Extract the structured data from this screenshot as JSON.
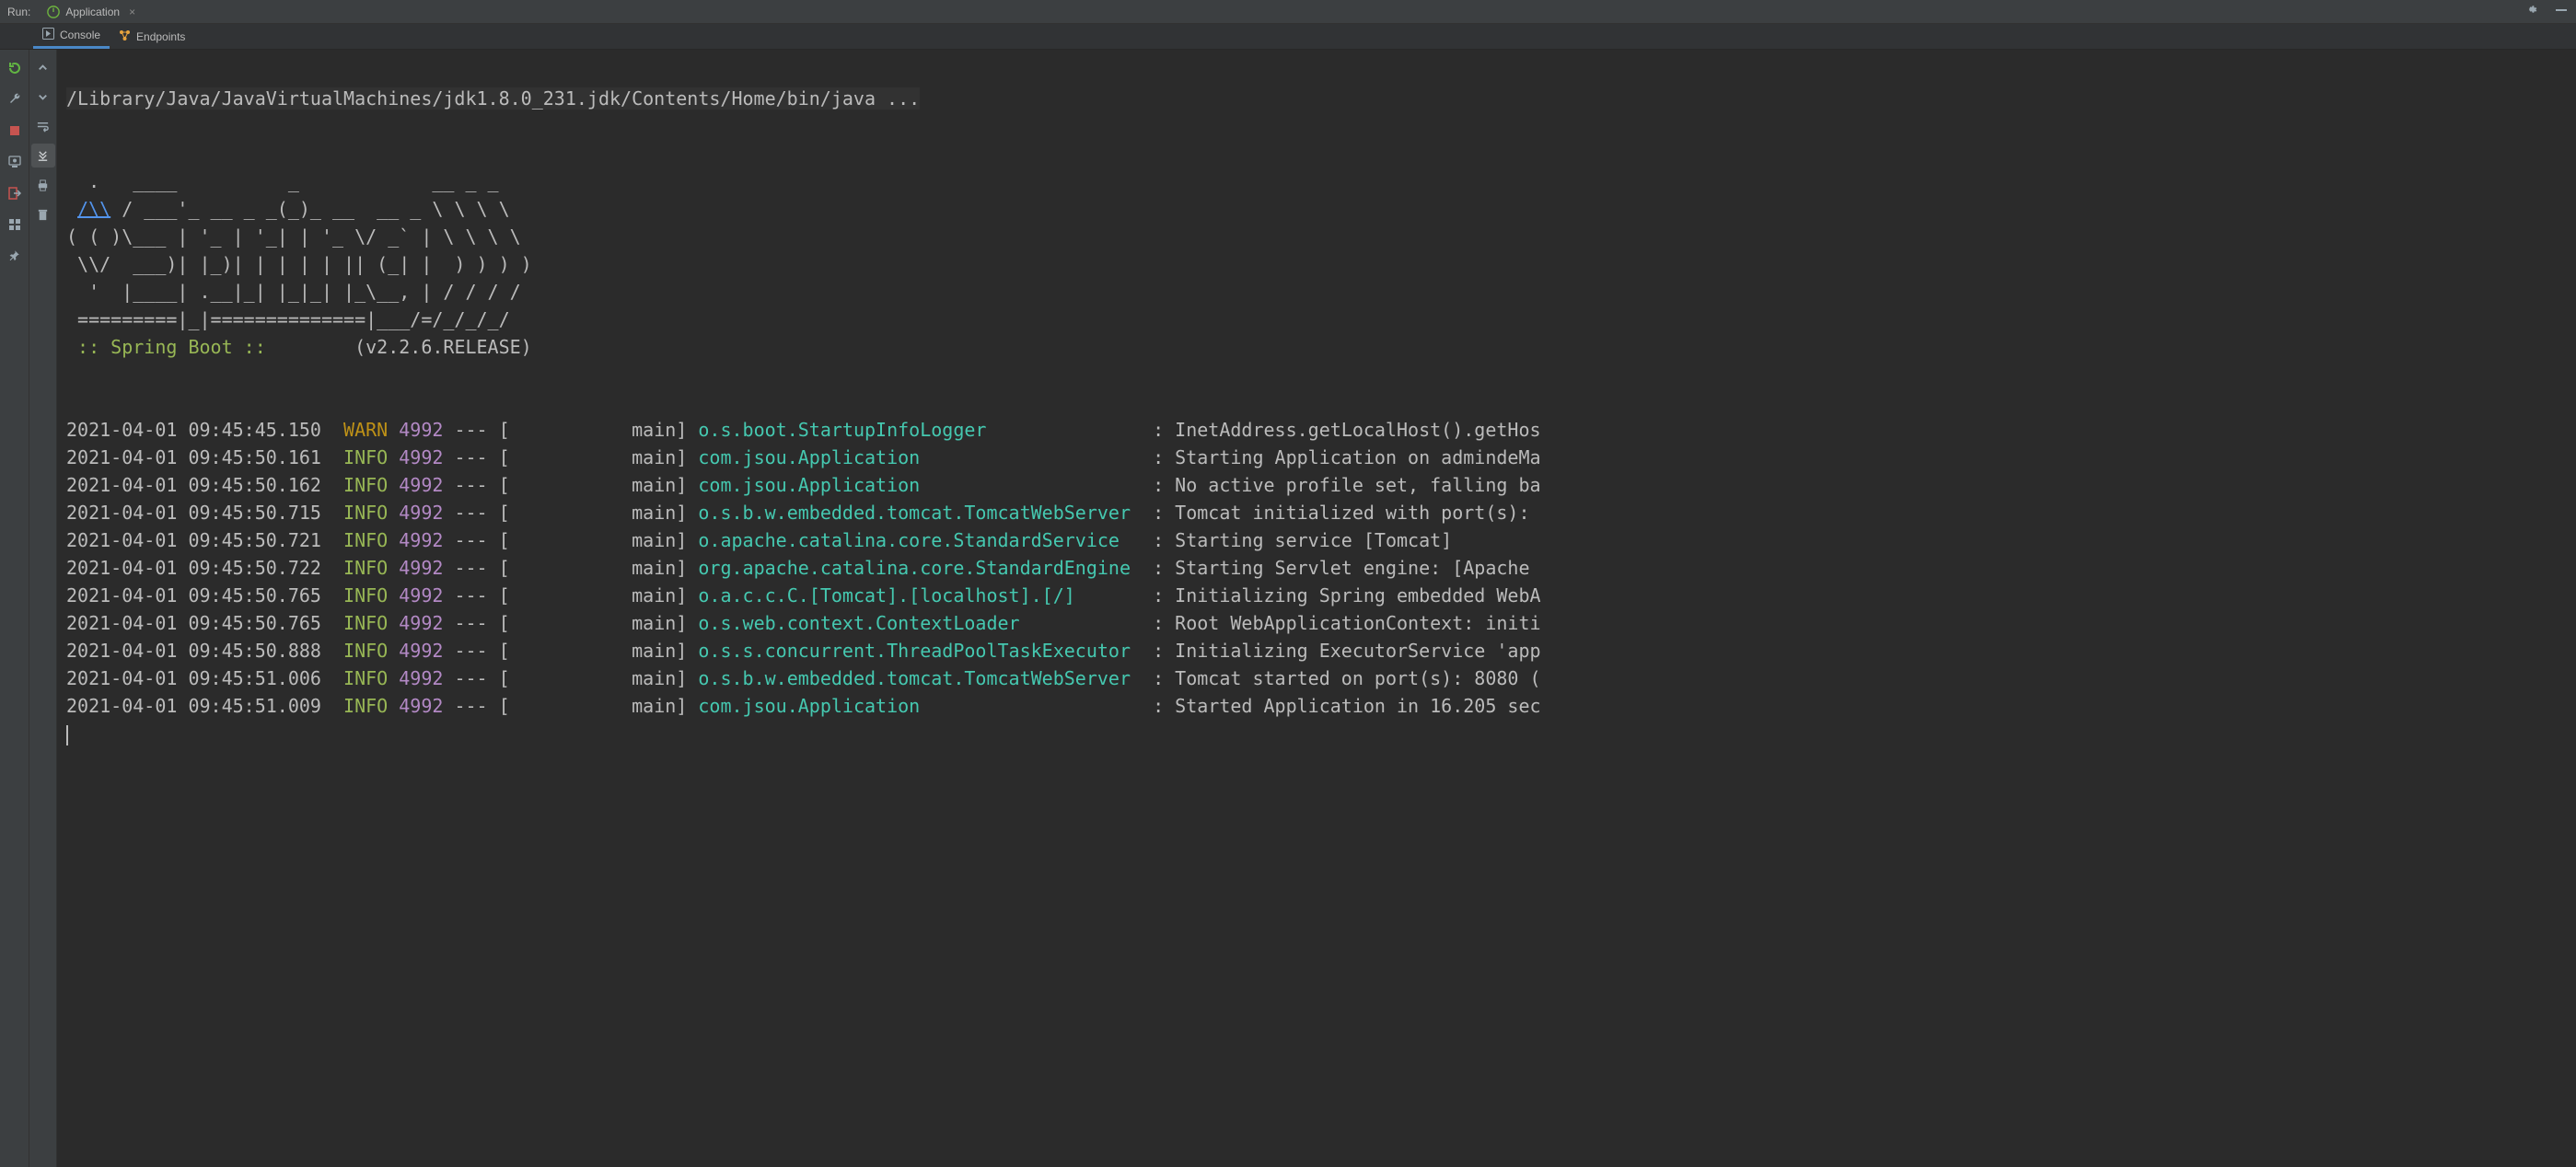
{
  "header": {
    "run_label": "Run:",
    "app_tab": "Application",
    "gear_icon": "gear-icon",
    "minimize_icon": "minimize-icon"
  },
  "subtabs": {
    "console": "Console",
    "endpoints": "Endpoints"
  },
  "console": {
    "cmd": "/Library/Java/JavaVirtualMachines/jdk1.8.0_231.jdk/Contents/Home/bin/java ...",
    "banner": {
      "l1": "  .   ____          _            __ _ _",
      "l2_pre": " ",
      "l2_link": "/\\\\",
      "l2_post": " / ___'_ __ _ _(_)_ __  __ _ \\ \\ \\ \\",
      "l3": "( ( )\\___ | '_ | '_| | '_ \\/ _` | \\ \\ \\ \\",
      "l4": " \\\\/  ___)| |_)| | | | | || (_| |  ) ) ) )",
      "l5": "  '  |____| .__|_| |_|_| |_\\__, | / / / /",
      "l6": " =========|_|==============|___/=/_/_/_/",
      "sb_label": " :: Spring Boot :: ",
      "sb_version": "       (v2.2.6.RELEASE)"
    },
    "logs": [
      {
        "ts": "2021-04-01 09:45:45.150",
        "level": "WARN",
        "pid": "4992",
        "sep": " --- [           main] ",
        "cls": "o.s.boot.StartupInfoLogger            ",
        "colon": "   : ",
        "msg": "InetAddress.getLocalHost().getHos"
      },
      {
        "ts": "2021-04-01 09:45:50.161",
        "level": "INFO",
        "pid": "4992",
        "sep": " --- [           main] ",
        "cls": "com.jsou.Application                  ",
        "colon": "   : ",
        "msg": "Starting Application on admindeMa"
      },
      {
        "ts": "2021-04-01 09:45:50.162",
        "level": "INFO",
        "pid": "4992",
        "sep": " --- [           main] ",
        "cls": "com.jsou.Application                  ",
        "colon": "   : ",
        "msg": "No active profile set, falling ba"
      },
      {
        "ts": "2021-04-01 09:45:50.715",
        "level": "INFO",
        "pid": "4992",
        "sep": " --- [           main] ",
        "cls": "o.s.b.w.embedded.tomcat.TomcatWebServer",
        "colon": "  : ",
        "msg": "Tomcat initialized with port(s): "
      },
      {
        "ts": "2021-04-01 09:45:50.721",
        "level": "INFO",
        "pid": "4992",
        "sep": " --- [           main] ",
        "cls": "o.apache.catalina.core.StandardService",
        "colon": "   : ",
        "msg": "Starting service [Tomcat]"
      },
      {
        "ts": "2021-04-01 09:45:50.722",
        "level": "INFO",
        "pid": "4992",
        "sep": " --- [           main] ",
        "cls": "org.apache.catalina.core.StandardEngine",
        "colon": "  : ",
        "msg": "Starting Servlet engine: [Apache "
      },
      {
        "ts": "2021-04-01 09:45:50.765",
        "level": "INFO",
        "pid": "4992",
        "sep": " --- [           main] ",
        "cls": "o.a.c.c.C.[Tomcat].[localhost].[/]   ",
        "colon": "    : ",
        "msg": "Initializing Spring embedded WebA"
      },
      {
        "ts": "2021-04-01 09:45:50.765",
        "level": "INFO",
        "pid": "4992",
        "sep": " --- [           main] ",
        "cls": "o.s.web.context.ContextLoader         ",
        "colon": "   : ",
        "msg": "Root WebApplicationContext: initi"
      },
      {
        "ts": "2021-04-01 09:45:50.888",
        "level": "INFO",
        "pid": "4992",
        "sep": " --- [           main] ",
        "cls": "o.s.s.concurrent.ThreadPoolTaskExecutor",
        "colon": "  : ",
        "msg": "Initializing ExecutorService 'app"
      },
      {
        "ts": "2021-04-01 09:45:51.006",
        "level": "INFO",
        "pid": "4992",
        "sep": " --- [           main] ",
        "cls": "o.s.b.w.embedded.tomcat.TomcatWebServer",
        "colon": "  : ",
        "msg": "Tomcat started on port(s): 8080 ("
      },
      {
        "ts": "2021-04-01 09:45:51.009",
        "level": "INFO",
        "pid": "4992",
        "sep": " --- [           main] ",
        "cls": "com.jsou.Application                  ",
        "colon": "   : ",
        "msg": "Started Application in 16.205 sec"
      }
    ]
  }
}
